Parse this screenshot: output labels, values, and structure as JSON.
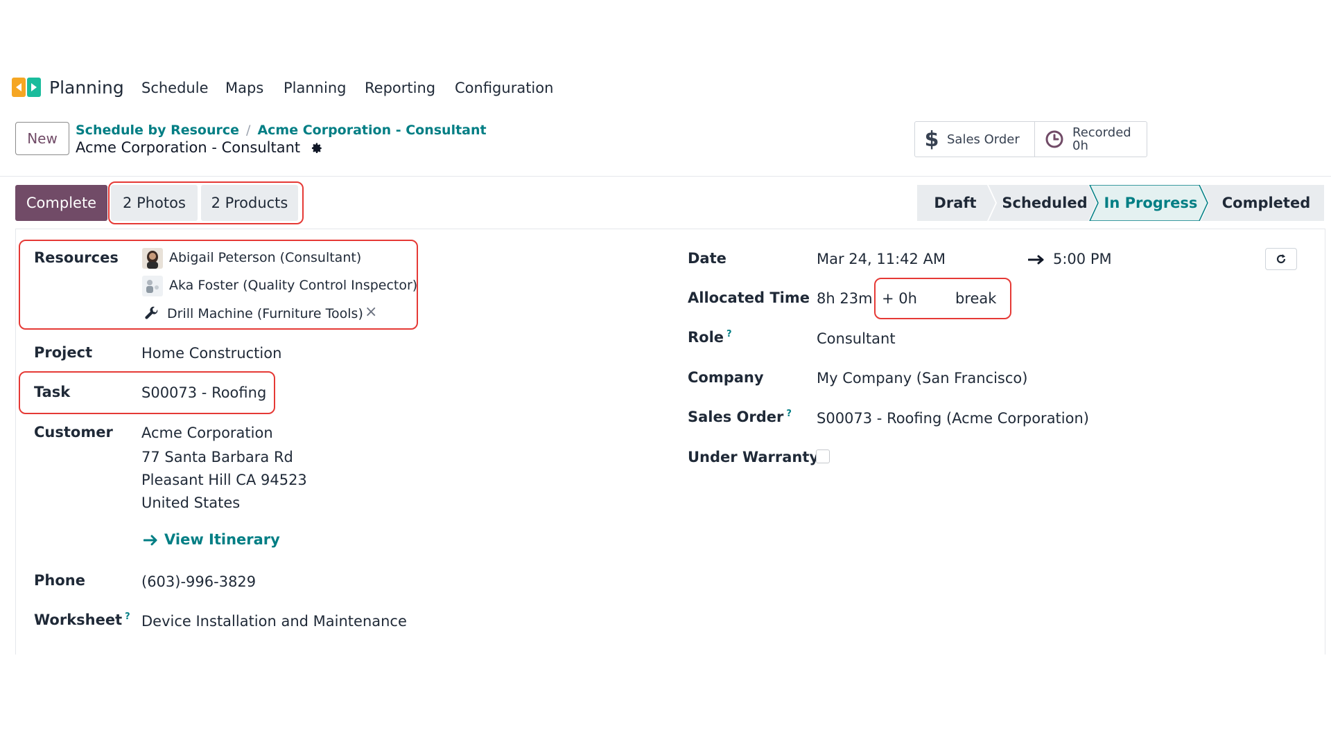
{
  "app": {
    "name": "Planning",
    "logo_icon": "planning-logo-icon"
  },
  "menu": [
    "Schedule",
    "Maps",
    "Planning",
    "Reporting",
    "Configuration"
  ],
  "control": {
    "new_label": "New",
    "breadcrumb": [
      "Schedule by Resource",
      "Acme Corporation - Consultant"
    ],
    "record_title": "Acme Corporation - Consultant",
    "smart_buttons": {
      "sales_order": "Sales Order",
      "recorded_label": "Recorded",
      "recorded_value": "0h"
    }
  },
  "statusbar": {
    "actions": [
      "Complete",
      "2 Photos",
      "2 Products"
    ],
    "stages": [
      "Draft",
      "Scheduled",
      "In Progress",
      "Completed"
    ],
    "current_stage": "In Progress"
  },
  "form": {
    "labels": {
      "resources": "Resources",
      "project": "Project",
      "task": "Task",
      "customer": "Customer",
      "phone": "Phone",
      "worksheet": "Worksheet",
      "date": "Date",
      "allocated_time": "Allocated Time",
      "role": "Role",
      "company": "Company",
      "sales_order": "Sales Order",
      "under_warranty": "Under Warranty"
    },
    "help_mark": "?",
    "resources": [
      "Abigail Peterson (Consultant)",
      "Aka Foster (Quality Control Inspector)",
      "Drill Machine (Furniture Tools)"
    ],
    "remove_symbol": "×",
    "project": "Home Construction",
    "task": "S00073 - Roofing",
    "customer_lines": [
      "Acme Corporation",
      "77 Santa Barbara Rd",
      "Pleasant Hill CA 94523",
      "United States"
    ],
    "view_itinerary": "View Itinerary",
    "phone": "(603)-996-3829",
    "worksheet": "Device Installation and Maintenance",
    "date_start": "Mar 24, 11:42 AM",
    "date_end": "5:00 PM",
    "allocated_time": "8h 23m",
    "break_value": "+ 0h",
    "break_label": "break",
    "role": "Consultant",
    "company": "My Company (San Francisco)",
    "sales_order": "S00073 - Roofing (Acme Corporation)",
    "under_warranty": false
  },
  "colors": {
    "brand": "#714b67",
    "link": "#017e84",
    "highlight": "#e53935"
  }
}
